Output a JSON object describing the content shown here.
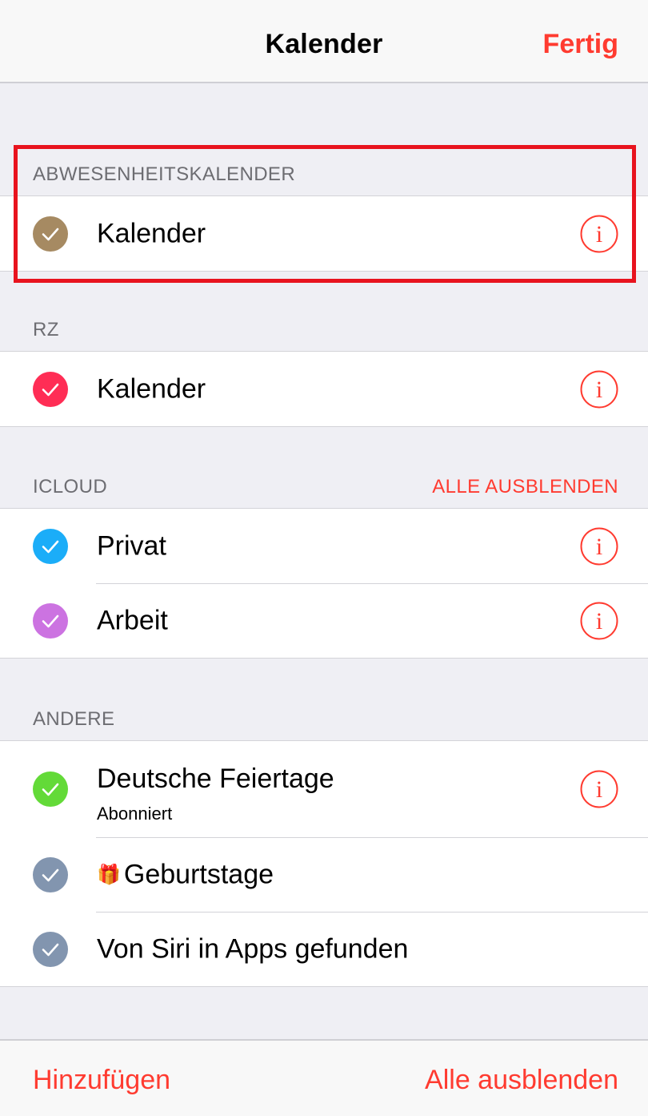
{
  "navbar": {
    "title": "Kalender",
    "done_label": "Fertig"
  },
  "sections": [
    {
      "header": "ABWESENHEITSKALENDER",
      "highlighted": true,
      "rows": [
        {
          "label": "Kalender",
          "color": "#a68a62",
          "checked": true,
          "info": true
        }
      ]
    },
    {
      "header": "RZ",
      "rows": [
        {
          "label": "Kalender",
          "color": "#ff2d55",
          "checked": true,
          "info": true
        }
      ]
    },
    {
      "header": "ICLOUD",
      "action": "ALLE AUSBLENDEN",
      "rows": [
        {
          "label": "Privat",
          "color": "#1badf8",
          "checked": true,
          "info": true
        },
        {
          "label": "Arbeit",
          "color": "#cc73e1",
          "checked": true,
          "info": true
        }
      ]
    },
    {
      "header": "ANDERE",
      "rows": [
        {
          "label": "Deutsche Feiertage",
          "sublabel": "Abonniert",
          "color": "#63da38",
          "checked": true,
          "info": true
        },
        {
          "label": "Geburtstage",
          "color": "#8295af",
          "checked": true,
          "info": false,
          "icon": "gift-icon"
        },
        {
          "label": "Von Siri in Apps gefunden",
          "color": "#8295af",
          "checked": true,
          "info": false
        }
      ]
    }
  ],
  "toolbar": {
    "add_label": "Hinzufügen",
    "hide_all_label": "Alle ausblenden"
  },
  "colors": {
    "accent": "#ff3b30",
    "highlight_box": "#e8131e"
  }
}
